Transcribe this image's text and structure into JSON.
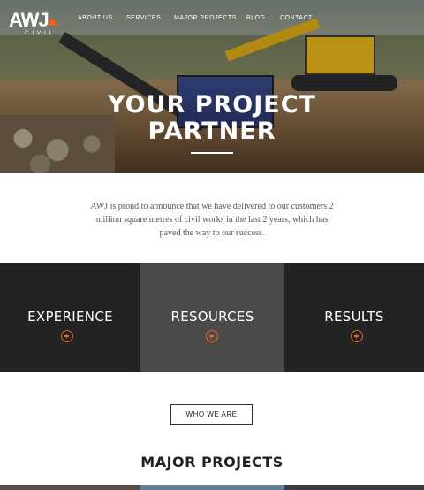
{
  "logo": {
    "text": "AWJ",
    "subtext": "CIVIL"
  },
  "nav": {
    "items": [
      {
        "label": "ABOUT US"
      },
      {
        "label": "SERVICES"
      },
      {
        "label": "MAJOR PROJECTS"
      },
      {
        "label": "BLOG"
      },
      {
        "label": "CONTACT"
      }
    ]
  },
  "hero": {
    "title_line1": "YOUR PROJECT",
    "title_line2": "PARTNER"
  },
  "intro": {
    "text": "AWJ is proud to announce that we have delivered to our customers 2 million square metres of civil works in the last 2 years, which has paved the way to our success."
  },
  "panels": [
    {
      "title": "EXPERIENCE",
      "color": "#232323"
    },
    {
      "title": "RESOURCES",
      "color": "#4a4a4a"
    },
    {
      "title": "RESULTS",
      "color": "#232323"
    }
  ],
  "who_button": {
    "label": "WHO WE ARE"
  },
  "projects": {
    "title": "MAJOR PROJECTS"
  },
  "colors": {
    "accent": "#e8621c",
    "dark": "#232323",
    "mid": "#4a4a4a"
  },
  "icons": {
    "panel_expand": "plus-circle-icon"
  }
}
